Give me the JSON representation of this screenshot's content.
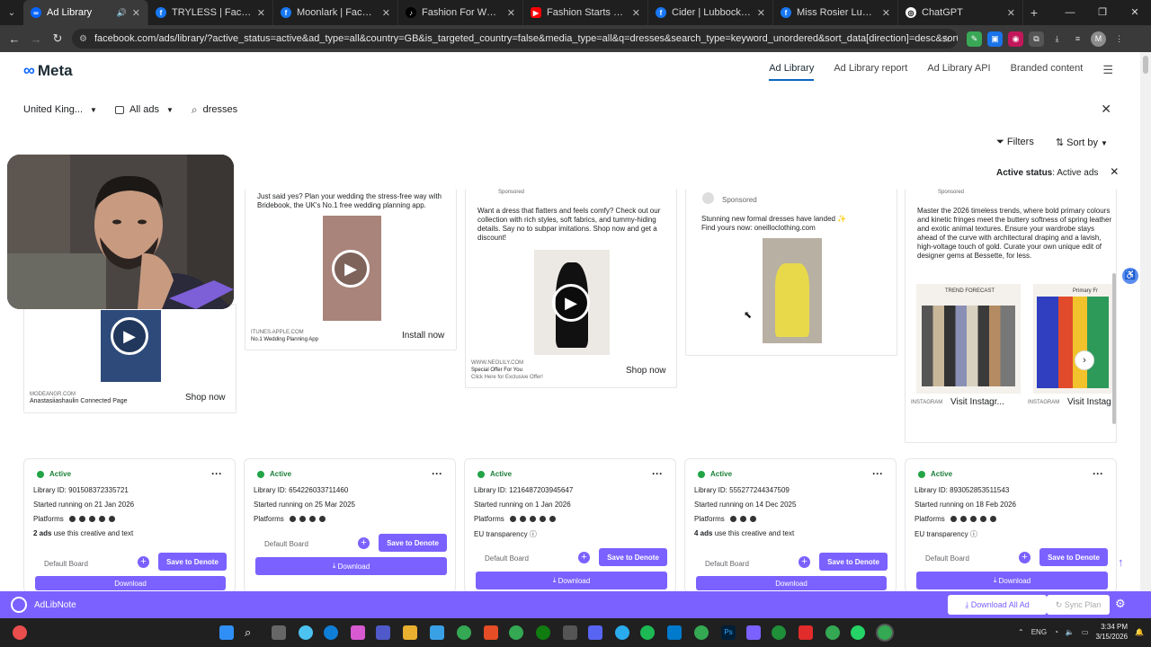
{
  "browser": {
    "tabs": [
      {
        "label": "Ad Library",
        "active": true,
        "icon": "meta-icon",
        "audio": true
      },
      {
        "label": "TRYLESS | Facebook",
        "icon": "facebook-icon"
      },
      {
        "label": "Moonlark | Facebook",
        "icon": "facebook-icon"
      },
      {
        "label": "Fashion For Women | Offic",
        "icon": "tiktok-icon"
      },
      {
        "label": "Fashion Starts With A Fee",
        "icon": "youtube-icon"
      },
      {
        "label": "Cider | Lubbock TX | Facet",
        "icon": "facebook-icon"
      },
      {
        "label": "Miss Rosier Lux | Croydon",
        "icon": "facebook-icon"
      },
      {
        "label": "ChatGPT",
        "icon": "chatgpt-icon"
      }
    ],
    "url": "facebook.com/ads/library/?active_status=active&ad_type=all&country=GB&is_targeted_country=false&media_type=all&q=dresses&search_type=keyword_unordered&sort_data[direction]=desc&sort_data[mode]=total_impre..."
  },
  "header": {
    "logo": "Meta",
    "nav": [
      "Ad Library",
      "Ad Library report",
      "Ad Library API",
      "Branded content"
    ]
  },
  "search": {
    "country": "United King...",
    "ad_type": "All ads",
    "query": "dresses"
  },
  "controls": {
    "filters": "Filters",
    "sort": "Sort by",
    "status_label": "Active status",
    "status_value": "Active ads"
  },
  "previews": [
    {
      "url": "MODEANGR.COM",
      "page": "Anastasiiashaulin Connected Page",
      "cta": "Shop now"
    },
    {
      "text": "Just said yes? Plan your wedding the stress-free way with Bridebook, the UK's No.1 free wedding planning app.",
      "url": "ITUNES.APPLE.COM",
      "caption": "No.1 Wedding Planning App",
      "cta": "Install now"
    },
    {
      "label": "Sponsored",
      "text": "Want a dress that flatters and feels comfy? Check out our collection with rich styles, soft fabrics, and tummy-hiding details. Say no to subpar imitations. Shop now and get a discount!",
      "url": "WWW.NEOLILY.COM",
      "caption": "Special Offer For You",
      "caption2": "Click Here for Exclusive Offer!",
      "cta": "Shop now"
    },
    {
      "label": "Sponsored",
      "text": "Stunning new formal dresses have landed ✨",
      "text2": "Find yours now: oneilloclothing.com"
    },
    {
      "label": "Sponsored",
      "text": "Master the 2026 timeless trends, where bold primary colours and kinetic fringes meet the buttery softness of spring leather and exotic animal textures.  Ensure your wardrobe stays ahead of the curve with architectural draping and a lavish, high-voltage touch of gold. Curate your own unique edit of designer gems at Bessette, for less.",
      "img_caption": "TREND FORECAST",
      "img_caption2": "Primary Fr",
      "url": "INSTAGRAM",
      "cta": "Visit Instagr...",
      "cta2": "Visit Instag"
    }
  ],
  "results": [
    {
      "status": "Active",
      "library_id": "Library ID: 901508372335721",
      "started": "Started running on 21 Jan 2026",
      "platforms": "Platforms",
      "extra_bold": "2 ads",
      "extra": " use this creative and text",
      "board": "Default Board",
      "save": "Save to Denote",
      "download": "Download"
    },
    {
      "status": "Active",
      "library_id": "Library ID: 654226033711460",
      "started": "Started running on 25 Mar 2025",
      "platforms": "Platforms",
      "board": "Default Board",
      "save": "Save to Denote",
      "download": "Download"
    },
    {
      "status": "Active",
      "library_id": "Library ID: 1216487203945647",
      "started": "Started running on 1 Jan 2026",
      "platforms": "Platforms",
      "extra": "EU transparency",
      "board": "Default Board",
      "save": "Save to Denote",
      "download": "Download"
    },
    {
      "status": "Active",
      "library_id": "Library ID: 555277244347509",
      "started": "Started running on 14 Dec 2025",
      "platforms": "Platforms",
      "extra_bold": "4 ads",
      "extra": " use this creative and text",
      "board": "Default Board",
      "save": "Save to Denote",
      "download": "Download"
    },
    {
      "status": "Active",
      "library_id": "Library ID: 893052853511543",
      "started": "Started running on 18 Feb 2026",
      "platforms": "Platforms",
      "extra": "EU transparency",
      "board": "Default Board",
      "save": "Save to Denote",
      "download": "Download"
    }
  ],
  "plugin": {
    "name": "AdLibNote",
    "download_all": "Download All Ad",
    "sync": "Sync Plan"
  },
  "taskbar": {
    "lang": "ENG",
    "time": "3:34 PM",
    "date": "3/15/2026"
  },
  "colors": {
    "accent": "#7b61ff",
    "meta_blue": "#0866ff",
    "active_green": "#22a447"
  }
}
